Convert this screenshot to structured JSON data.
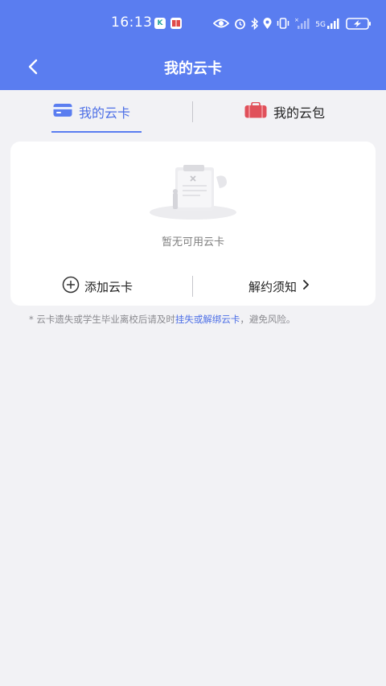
{
  "status_bar": {
    "time": "16:13",
    "app_icons": [
      "K",
      "📖"
    ],
    "network_label": "5G",
    "icons": [
      "eye-icon",
      "alarm-icon",
      "bluetooth-icon",
      "location-icon",
      "vibrate-icon",
      "signal-icon",
      "battery-icon"
    ]
  },
  "nav": {
    "title": "我的云卡"
  },
  "tabs": [
    {
      "label": "我的云卡",
      "active": true
    },
    {
      "label": "我的云包",
      "active": false
    }
  ],
  "empty": {
    "message": "暂无可用云卡"
  },
  "actions": {
    "add_label": "添加云卡",
    "terms_label": "解约须知",
    "terms_arrow": "›"
  },
  "notice": {
    "prefix": "* 云卡遗失或学生毕业离校后请及时",
    "link": "挂失或解绑云卡",
    "suffix": "，避免风险。"
  },
  "colors": {
    "primary": "#5a7df0",
    "accent_text": "#4d6fe6",
    "background": "#f2f2f5",
    "wallet_icon": "#e0505a"
  }
}
